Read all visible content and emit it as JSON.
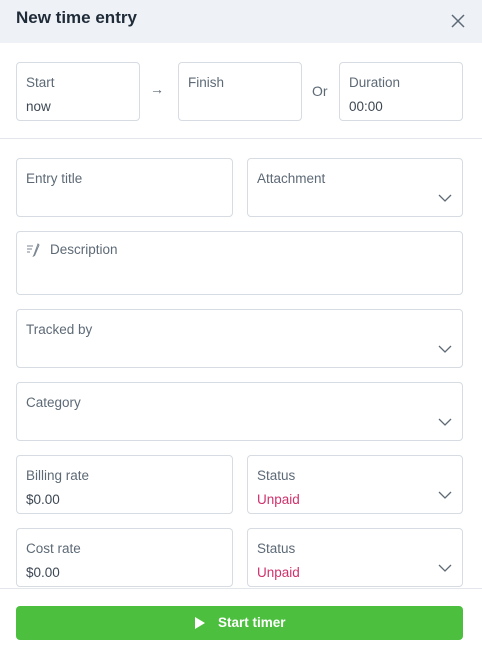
{
  "header": {
    "title": "New time entry"
  },
  "time": {
    "start_label": "Start",
    "start_value": "now",
    "arrow": "→",
    "finish_label": "Finish",
    "or_text": "Or",
    "duration_label": "Duration",
    "duration_value": "00:00"
  },
  "fields": {
    "entry_title_label": "Entry title",
    "attachment_label": "Attachment",
    "description_label": "Description",
    "tracked_by_label": "Tracked by",
    "category_label": "Category",
    "billing_rate_label": "Billing rate",
    "billing_rate_value": "$0.00",
    "billing_status_label": "Status",
    "billing_status_value": "Unpaid",
    "cost_rate_label": "Cost rate",
    "cost_rate_value": "$0.00",
    "cost_status_label": "Status",
    "cost_status_value": "Unpaid"
  },
  "colors": {
    "accent_green": "#4dbf3e",
    "unpaid": "#d0316b",
    "header_bg": "#eef2f6"
  },
  "footer": {
    "start_timer_label": "Start timer"
  }
}
